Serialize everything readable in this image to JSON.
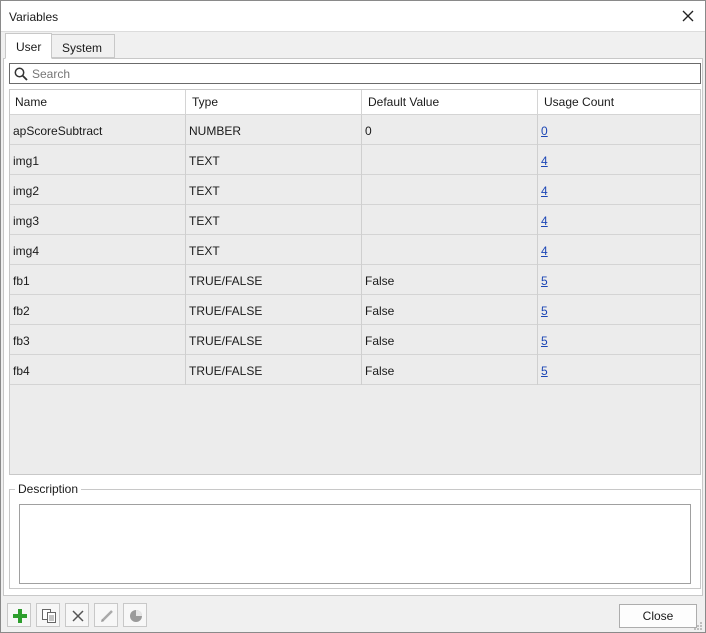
{
  "window": {
    "title": "Variables"
  },
  "tabs": [
    {
      "label": "User"
    },
    {
      "label": "System"
    }
  ],
  "search": {
    "placeholder": "Search",
    "value": ""
  },
  "table": {
    "headers": [
      "Name",
      "Type",
      "Default Value",
      "Usage Count"
    ],
    "rows": [
      {
        "name": "apScoreSubtract",
        "type": "NUMBER",
        "default": "0",
        "usage": "0"
      },
      {
        "name": "img1",
        "type": "TEXT",
        "default": "",
        "usage": "4"
      },
      {
        "name": "img2",
        "type": "TEXT",
        "default": "",
        "usage": "4"
      },
      {
        "name": "img3",
        "type": "TEXT",
        "default": "",
        "usage": "4"
      },
      {
        "name": "img4",
        "type": "TEXT",
        "default": "",
        "usage": "4"
      },
      {
        "name": "fb1",
        "type": "TRUE/FALSE",
        "default": "False",
        "usage": "5"
      },
      {
        "name": "fb2",
        "type": "TRUE/FALSE",
        "default": "False",
        "usage": "5"
      },
      {
        "name": "fb3",
        "type": "TRUE/FALSE",
        "default": "False",
        "usage": "5"
      },
      {
        "name": "fb4",
        "type": "TRUE/FALSE",
        "default": "False",
        "usage": "5"
      }
    ]
  },
  "description": {
    "label": "Description",
    "value": ""
  },
  "toolbar": {
    "icons": [
      "add-icon",
      "copy-icon",
      "delete-icon",
      "edit-icon",
      "pie-chart-icon"
    ]
  },
  "footer": {
    "close_label": "Close"
  },
  "colors": {
    "link": "#1c46b5",
    "add": "#2e9e2e"
  }
}
